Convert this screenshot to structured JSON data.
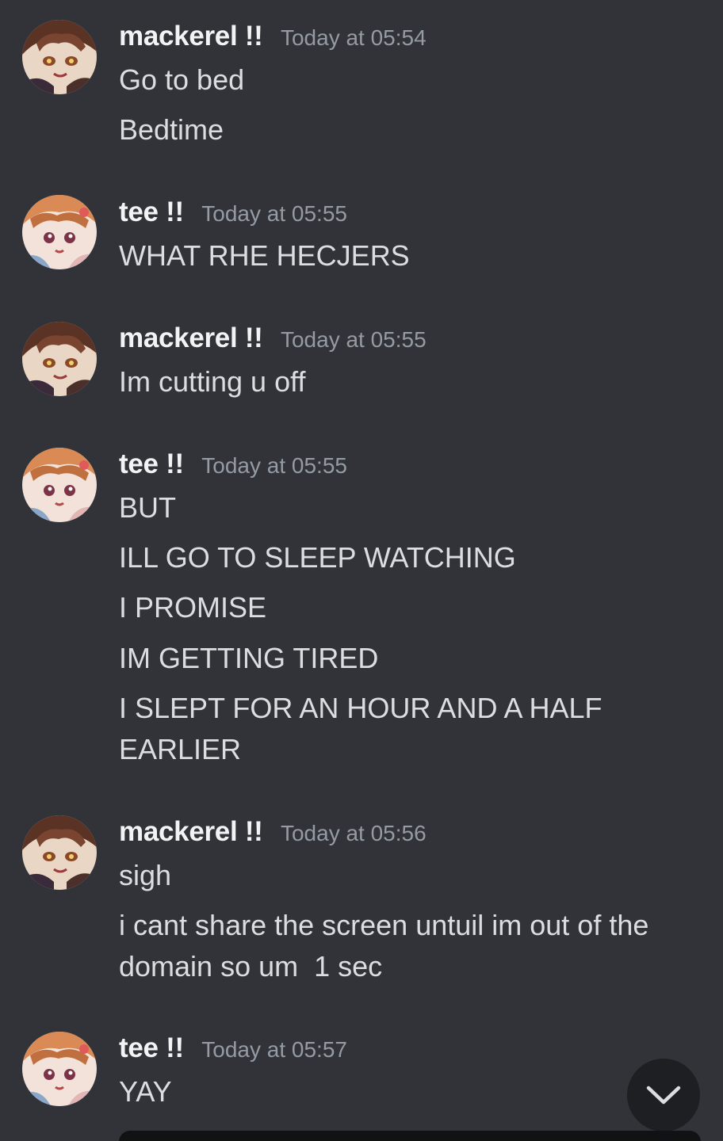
{
  "messages": [
    {
      "username": "mackerel !!",
      "timestamp": "Today at 05:54",
      "avatar": "mackerel-avatar",
      "lines": [
        "Go to bed",
        "Bedtime"
      ]
    },
    {
      "username": "tee !!",
      "timestamp": "Today at 05:55",
      "avatar": "tee-avatar",
      "lines": [
        "WHAT RHE HECJERS"
      ]
    },
    {
      "username": "mackerel !!",
      "timestamp": "Today at 05:55",
      "avatar": "mackerel-avatar",
      "lines": [
        "Im cutting u off"
      ]
    },
    {
      "username": "tee !!",
      "timestamp": "Today at 05:55",
      "avatar": "tee-avatar",
      "lines": [
        "BUT",
        "ILL GO TO SLEEP WATCHING",
        "I PROMISE",
        "IM GETTING TIRED",
        "I SLEPT FOR AN HOUR AND A HALF EARLIER"
      ]
    },
    {
      "username": "mackerel !!",
      "timestamp": "Today at 05:56",
      "avatar": "mackerel-avatar",
      "lines": [
        "sigh",
        "i cant share the screen untuil im out of the domain so um  1 sec"
      ]
    },
    {
      "username": "tee !!",
      "timestamp": "Today at 05:57",
      "avatar": "tee-avatar",
      "lines": [
        "YAY"
      ]
    }
  ],
  "controls": {
    "scroll_to_bottom_icon": "chevron-down-icon"
  },
  "colors": {
    "background": "#313338",
    "username": "#f2f3f5",
    "timestamp": "#949ba4",
    "message_text": "#dbdee1",
    "scroll_button": "#1e1f22"
  }
}
